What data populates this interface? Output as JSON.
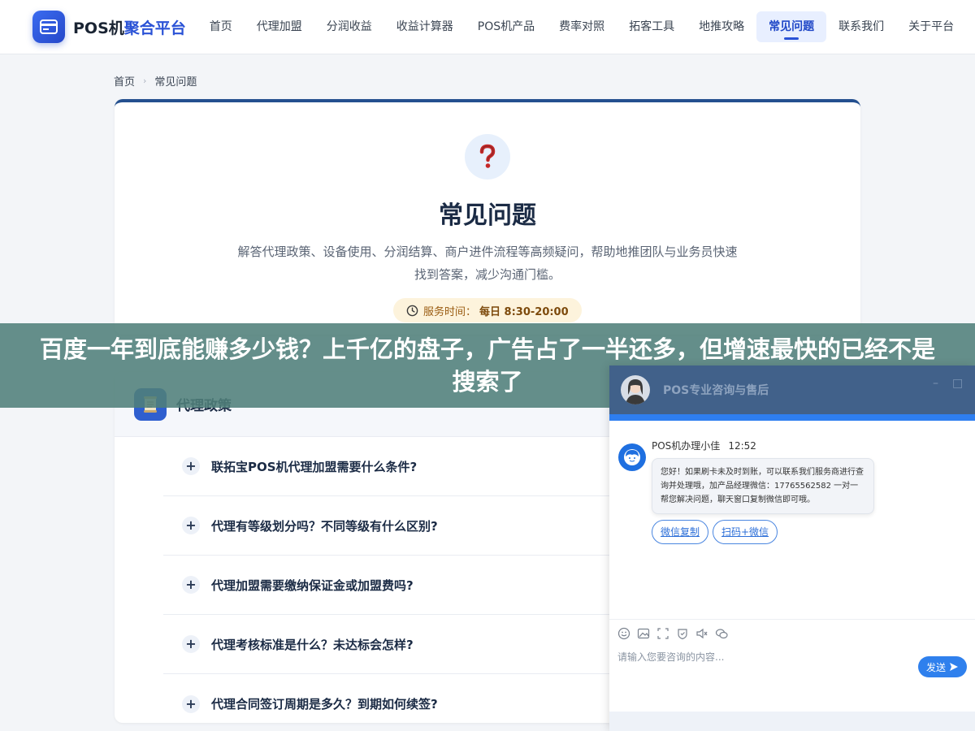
{
  "brand": {
    "name_part1": "POS机",
    "name_part2": "聚合平台"
  },
  "nav": [
    {
      "label": "首页",
      "active": false
    },
    {
      "label": "代理加盟",
      "active": false
    },
    {
      "label": "分润收益",
      "active": false
    },
    {
      "label": "收益计算器",
      "active": false
    },
    {
      "label": "POS机产品",
      "active": false
    },
    {
      "label": "费率对照",
      "active": false
    },
    {
      "label": "拓客工具",
      "active": false
    },
    {
      "label": "地推攻略",
      "active": false
    },
    {
      "label": "常见问题",
      "active": true
    },
    {
      "label": "联系我们",
      "active": false
    },
    {
      "label": "关于平台",
      "active": false
    }
  ],
  "breadcrumb": {
    "home": "首页",
    "current": "常见问题"
  },
  "hero": {
    "title": "常见问题",
    "description": "解答代理政策、设备使用、分润结算、商户进件流程等高频疑问，帮助地推团队与业务员快速找到答案，减少沟通门槛。",
    "hours_label": "服务时间：",
    "hours_value": "每日 8:30-20:00"
  },
  "faq": {
    "section_title": "代理政策",
    "questions": [
      "联拓宝POS机代理加盟需要什么条件?",
      "代理有等级划分吗？不同等级有什么区别?",
      "代理加盟需要缴纳保证金或加盟费吗?",
      "代理考核标准是什么？未达标会怎样?",
      "代理合同签订周期是多久？到期如何续签?"
    ]
  },
  "banner": {
    "text": "百度一年到底能赚多少钱？上千亿的盘子，广告占了一半还多，但增速最快的已经不是搜索了"
  },
  "chat": {
    "header_title": "POS专业咨询与售后",
    "agent_name": "POS机办理小佳",
    "time": "12:52",
    "message": "您好！如果刷卡未及时到账，可以联系我们服务商进行查询并处理哦，加产品经理微信：17765562582 一对一帮您解决问题，聊天窗口复制微信即可哦。",
    "quick_reply_1": "微信复制",
    "quick_reply_2": "扫码+微信",
    "input_placeholder": "请输入您要咨询的内容...",
    "send_label": "发送"
  },
  "colors": {
    "accent": "#2a52d6",
    "banner": "#50807a",
    "chat_header": "#41618a",
    "chat_accent": "#2e7ef0"
  }
}
